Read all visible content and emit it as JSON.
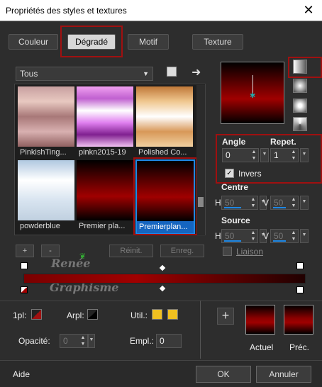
{
  "window": {
    "title": "Propriétés des styles et textures",
    "close_glyph": "✕"
  },
  "tabs": [
    {
      "label": "Couleur"
    },
    {
      "label": "Dégradé"
    },
    {
      "label": "Motif"
    },
    {
      "label": "Texture"
    }
  ],
  "library": {
    "category": "Tous",
    "thumbnails": [
      {
        "label": "PinkishTing...",
        "gradient": "linear-gradient(#c8a0a0,#e8c8c0,#a87878,#d8b0b0,#906060)"
      },
      {
        "label": "pinkn2015-19",
        "gradient": "linear-gradient(#f0a0f0,#c060d0,#ffffff,#e080f0,#802090,#f0c0f0)"
      },
      {
        "label": "Polished Co...",
        "gradient": "linear-gradient(#c07838,#f0c890,#ffffff,#d89858,#f0d0a0)"
      },
      {
        "label": "powderblue",
        "gradient": "linear-gradient(#b0c8e0,#ffffff,#d8e4f0,#c0d0e0)"
      },
      {
        "label": "Premier pla...",
        "gradient": "linear-gradient(#000,#7a0000 45%,#a00000 60%,#000)"
      },
      {
        "label": "Premierplan...",
        "gradient": "linear-gradient(#000,#7a0000 45%,#a00000 60%,#000)"
      }
    ],
    "add_label": "+",
    "remove_label": "-",
    "reset_label": "Réinit.",
    "save_label": "Enreg."
  },
  "gradient": {
    "angle_label": "Angle",
    "angle_value": "0",
    "repeat_label": "Repet.",
    "repeat_value": "1",
    "invert_label": "Invers",
    "invert_checked": true,
    "center_label": "Centre",
    "center_h_label": "H",
    "center_h": "50",
    "center_v_label": "V",
    "center_v": "50",
    "source_label": "Source",
    "source_h_label": "H",
    "source_h": "50",
    "source_v_label": "V",
    "source_v": "50",
    "link_label": "Liaison"
  },
  "stops": {
    "fg_label": "1pl:",
    "bg_label": "Arpl:",
    "user_label": "Util.:",
    "opacity_label": "Opacité:",
    "opacity_value": "0",
    "position_label": "Empl.:",
    "position_value": "0",
    "user_colors": [
      "#f0c020",
      "#f0c020"
    ]
  },
  "swatches": {
    "add_label": "+",
    "current_label": "Actuel",
    "previous_label": "Préc."
  },
  "watermark": {
    "line1": "Renée",
    "line2": "Graphisme"
  },
  "footer": {
    "help_label": "Aide",
    "ok_label": "OK",
    "cancel_label": "Annuler"
  },
  "colors": {
    "accent": "#1e88e5",
    "highlight_red": "#a01010",
    "gradient_red": "#a00000"
  }
}
